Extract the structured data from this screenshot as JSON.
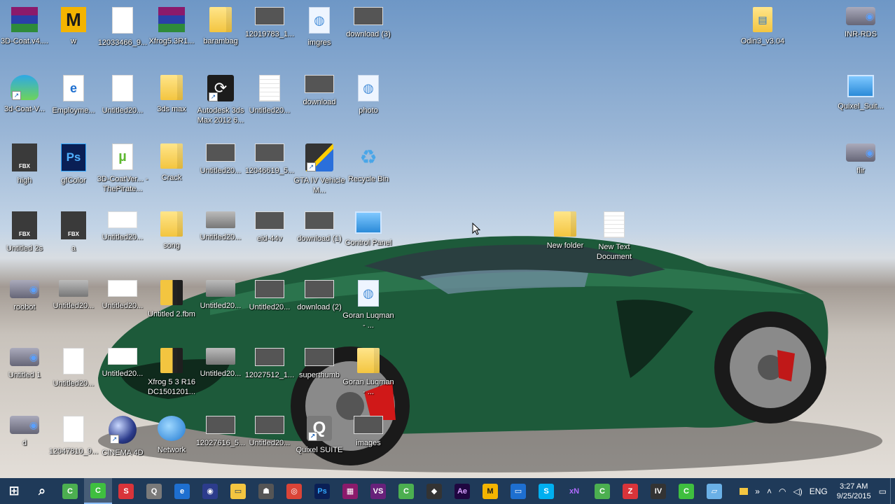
{
  "desktop": {
    "icons": [
      {
        "label": "3D-Coat.v4....",
        "icon": "winrar-archive-icon",
        "col": 0,
        "row": 0
      },
      {
        "label": "w",
        "icon": "m-app-icon",
        "col": 1,
        "row": 0
      },
      {
        "label": "12033466_9...",
        "icon": "blank-document-icon",
        "col": 2,
        "row": 0
      },
      {
        "label": "Xfrog5.3R1...",
        "icon": "winrar-archive-icon",
        "col": 3,
        "row": 0
      },
      {
        "label": "barambag",
        "icon": "folder-icon",
        "col": 4,
        "row": 0
      },
      {
        "label": "12019783_1...",
        "icon": "photo-thumbnail-icon",
        "col": 5,
        "row": 0
      },
      {
        "label": "imgres",
        "icon": "web-file-icon",
        "col": 6,
        "row": 0
      },
      {
        "label": "download (3)",
        "icon": "photo-thumbnail-icon",
        "col": 7,
        "row": 0
      },
      {
        "label": "3d-Coat-V...",
        "icon": "3d-coat-icon",
        "col": 0,
        "row": 1
      },
      {
        "label": "Employme...",
        "icon": "edge-pdf-icon",
        "col": 1,
        "row": 1
      },
      {
        "label": "Untitled20...",
        "icon": "blank-document-icon",
        "col": 2,
        "row": 1
      },
      {
        "label": "3ds max",
        "icon": "folder-icon",
        "col": 3,
        "row": 1
      },
      {
        "label": "Autodesk 3ds Max 2012 6...",
        "icon": "3ds-max-icon",
        "col": 4,
        "row": 1
      },
      {
        "label": "Untitled20...",
        "icon": "lined-document-icon",
        "col": 5,
        "row": 1
      },
      {
        "label": "download",
        "icon": "photo-thumbnail-icon",
        "col": 6,
        "row": 1
      },
      {
        "label": "photo",
        "icon": "web-file-icon",
        "col": 7,
        "row": 1
      },
      {
        "label": "high",
        "icon": "fbx-file-icon",
        "col": 0,
        "row": 2
      },
      {
        "label": "gfColor",
        "icon": "photoshop-file-icon",
        "col": 1,
        "row": 2
      },
      {
        "label": "3D-CoatVer... - ThePirate...",
        "icon": "torrent-file-icon",
        "col": 2,
        "row": 2
      },
      {
        "label": "Crack",
        "icon": "folder-icon",
        "col": 3,
        "row": 2
      },
      {
        "label": "Untitled20...",
        "icon": "photo-thumbnail-icon",
        "col": 4,
        "row": 2
      },
      {
        "label": "12046619_5...",
        "icon": "photo-thumbnail-icon",
        "col": 5,
        "row": 2
      },
      {
        "label": "GTA IV Vehicle M...",
        "icon": "gta-tool-icon",
        "col": 6,
        "row": 2
      },
      {
        "label": "Recycle Bin",
        "icon": "recycle-bin-icon",
        "col": 7,
        "row": 2
      },
      {
        "label": "Untitled 2s",
        "icon": "fbx-file-icon",
        "col": 0,
        "row": 3
      },
      {
        "label": "a",
        "icon": "fbx-file-icon",
        "col": 1,
        "row": 3
      },
      {
        "label": "Untitled20...",
        "icon": "white-thumbnail-icon",
        "col": 2,
        "row": 3
      },
      {
        "label": "song",
        "icon": "folder-icon",
        "col": 3,
        "row": 3
      },
      {
        "label": "Untitled20...",
        "icon": "grey-thumbnail-icon",
        "col": 4,
        "row": 3
      },
      {
        "label": "eid-44v",
        "icon": "photo-thumbnail-icon",
        "col": 5,
        "row": 3
      },
      {
        "label": "download (1)",
        "icon": "photo-thumbnail-icon",
        "col": 6,
        "row": 3
      },
      {
        "label": "Control Panel",
        "icon": "control-panel-icon",
        "col": 7,
        "row": 3
      },
      {
        "label": "roobot",
        "icon": "render-file-icon",
        "col": 0,
        "row": 4
      },
      {
        "label": "Untitled20...",
        "icon": "grey-thumbnail-icon",
        "col": 1,
        "row": 4
      },
      {
        "label": "Untitled20...",
        "icon": "white-thumbnail-icon",
        "col": 2,
        "row": 4
      },
      {
        "label": "Untitled 2.fbm",
        "icon": "dark-folder-icon",
        "col": 3,
        "row": 4
      },
      {
        "label": "Untitled20...",
        "icon": "grey-thumbnail-icon",
        "col": 4,
        "row": 4
      },
      {
        "label": "Untitled20...",
        "icon": "photo-thumbnail-icon",
        "col": 5,
        "row": 4
      },
      {
        "label": "download (2)",
        "icon": "photo-thumbnail-icon",
        "col": 6,
        "row": 4
      },
      {
        "label": "Goran Luqman - ...",
        "icon": "web-file-icon",
        "col": 7,
        "row": 4
      },
      {
        "label": "Untitled 1",
        "icon": "render-file-icon",
        "col": 0,
        "row": 5
      },
      {
        "label": "Untitled20...",
        "icon": "blank-document-icon",
        "col": 1,
        "row": 5
      },
      {
        "label": "Untitled20...",
        "icon": "white-thumbnail-icon",
        "col": 2,
        "row": 5
      },
      {
        "label": "Xfrog 5 3 R16 DC1501201...",
        "icon": "dark-folder-icon",
        "col": 3,
        "row": 5
      },
      {
        "label": "Untitled20...",
        "icon": "grey-thumbnail-icon",
        "col": 4,
        "row": 5
      },
      {
        "label": "12027512_1...",
        "icon": "photo-thumbnail-icon",
        "col": 5,
        "row": 5
      },
      {
        "label": "superthumb",
        "icon": "photo-thumbnail-icon",
        "col": 6,
        "row": 5
      },
      {
        "label": "Goran Luqman - ...",
        "icon": "folder-icon",
        "col": 7,
        "row": 5
      },
      {
        "label": "d",
        "icon": "render-file-icon",
        "col": 0,
        "row": 6
      },
      {
        "label": "12047810_9...",
        "icon": "blank-document-icon",
        "col": 1,
        "row": 6
      },
      {
        "label": "CINEMA 4D",
        "icon": "cinema-4d-icon",
        "col": 2,
        "row": 6
      },
      {
        "label": "Network",
        "icon": "network-icon",
        "col": 3,
        "row": 6
      },
      {
        "label": "12027616_5...",
        "icon": "photo-thumbnail-icon",
        "col": 4,
        "row": 6
      },
      {
        "label": "Untitled20...",
        "icon": "photo-thumbnail-icon",
        "col": 5,
        "row": 6
      },
      {
        "label": "Quixel SUITE",
        "icon": "quixel-suite-icon",
        "col": 6,
        "row": 6
      },
      {
        "label": "images",
        "icon": "photo-thumbnail-icon",
        "col": 7,
        "row": 6
      }
    ],
    "free_icons": [
      {
        "label": "New folder",
        "icon": "folder-icon",
        "pos": "nf"
      },
      {
        "label": "New Text Document",
        "icon": "lined-document-icon",
        "pos": "ntd"
      },
      {
        "label": "Odin3_v3.04",
        "icon": "odin-folder-icon",
        "pos": "odin"
      },
      {
        "label": "INR-RDS",
        "icon": "render-file-icon",
        "pos": "inr"
      },
      {
        "label": "Quixel_Suit...",
        "icon": "quixel-installer-icon",
        "pos": "qs"
      },
      {
        "label": "flir",
        "icon": "render-file-icon",
        "pos": "flir"
      }
    ]
  },
  "taskbar": {
    "apps": [
      {
        "name": "start-button",
        "glyph": "⊞",
        "color": "#ffffff",
        "bg": "transparent"
      },
      {
        "name": "search-button",
        "glyph": "⌕",
        "color": "#ffffff",
        "bg": "transparent"
      },
      {
        "name": "3d-coat-taskbar",
        "glyph": "C",
        "color": "#ffffff",
        "bg": "#4caf50"
      },
      {
        "name": "camtasia-taskbar",
        "glyph": "C",
        "color": "#ffffff",
        "bg": "#3fbf3f",
        "active": true
      },
      {
        "name": "substance-taskbar",
        "glyph": "S",
        "color": "#ffffff",
        "bg": "#d9343a"
      },
      {
        "name": "quixel-taskbar",
        "glyph": "Q",
        "color": "#ffffff",
        "bg": "#7a7a7a"
      },
      {
        "name": "edge-taskbar",
        "glyph": "e",
        "color": "#ffffff",
        "bg": "#1e6fd0"
      },
      {
        "name": "cinema4d-taskbar",
        "glyph": "◉",
        "color": "#ffffff",
        "bg": "#2c3c8c"
      },
      {
        "name": "file-explorer-taskbar",
        "glyph": "▭",
        "color": "#1f3a59",
        "bg": "#f3c540"
      },
      {
        "name": "game-app-taskbar",
        "glyph": "☗",
        "color": "#ffffff",
        "bg": "#555555"
      },
      {
        "name": "chrome-taskbar",
        "glyph": "◎",
        "color": "#ffffff",
        "bg": "#db4437"
      },
      {
        "name": "photoshop-taskbar",
        "glyph": "Ps",
        "color": "#31a8ff",
        "bg": "#0a1f55"
      },
      {
        "name": "keyboard-app-taskbar",
        "glyph": "▦",
        "color": "#ffffff",
        "bg": "#8b1a6b"
      },
      {
        "name": "visual-studio-taskbar",
        "glyph": "VS",
        "color": "#ffffff",
        "bg": "#68217a"
      },
      {
        "name": "3d-coat-2-taskbar",
        "glyph": "C",
        "color": "#ffffff",
        "bg": "#4caf50"
      },
      {
        "name": "unity-taskbar",
        "glyph": "◆",
        "color": "#ffffff",
        "bg": "#333333"
      },
      {
        "name": "after-effects-taskbar",
        "glyph": "Ae",
        "color": "#d8a1ff",
        "bg": "#1f0740"
      },
      {
        "name": "marmoset-taskbar",
        "glyph": "M",
        "color": "#1b1b1b",
        "bg": "#f4b400"
      },
      {
        "name": "remote-app-taskbar",
        "glyph": "▭",
        "color": "#ffffff",
        "bg": "#1e6fd0"
      },
      {
        "name": "skype-taskbar",
        "glyph": "S",
        "color": "#ffffff",
        "bg": "#00aff0"
      },
      {
        "name": "xnormal-taskbar",
        "glyph": "xN",
        "color": "#b06bff",
        "bg": "transparent"
      },
      {
        "name": "3d-coat-3-taskbar",
        "glyph": "C",
        "color": "#ffffff",
        "bg": "#4caf50"
      },
      {
        "name": "zbrush-taskbar",
        "glyph": "Z",
        "color": "#ffffff",
        "bg": "#d9343a"
      },
      {
        "name": "gta-iv-taskbar",
        "glyph": "IV",
        "color": "#ffffff",
        "bg": "#333333"
      },
      {
        "name": "camtasia-2-taskbar",
        "glyph": "C",
        "color": "#ffffff",
        "bg": "#3fbf3f"
      },
      {
        "name": "notes-app-taskbar",
        "glyph": "▱",
        "color": "#ffffff",
        "bg": "#6ab0e6"
      }
    ],
    "tray": {
      "language": "ENG",
      "time": "3:27 AM",
      "date": "9/25/2015"
    }
  }
}
